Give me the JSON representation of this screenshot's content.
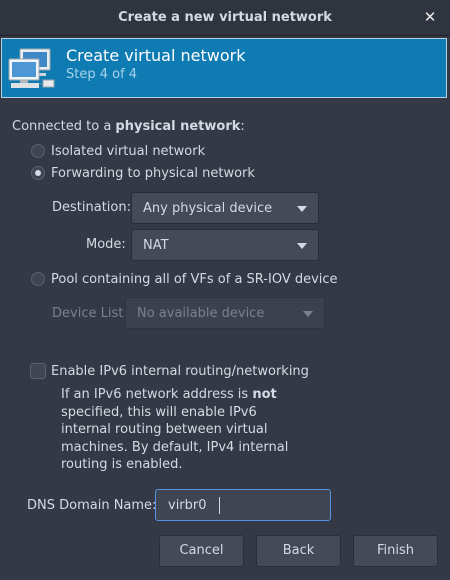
{
  "window": {
    "title": "Create a new virtual network"
  },
  "banner": {
    "title": "Create virtual network",
    "step": "Step 4 of 4",
    "icon": "network-computers-icon"
  },
  "connection": {
    "heading_prefix": "Connected to a ",
    "heading_bold": "physical network",
    "heading_suffix": ":",
    "isolated_label": "Isolated virtual network",
    "forwarding_label": "Forwarding to physical network",
    "selected": "forwarding",
    "destination_label": "Destination:",
    "destination_value": "Any physical device",
    "mode_label": "Mode:",
    "mode_value": "NAT",
    "pool_label": "Pool containing all of VFs of a SR-IOV device",
    "device_list_label": "Device List:",
    "device_list_value": "No available device"
  },
  "ipv6": {
    "label": "Enable IPv6 internal routing/networking",
    "checked": false,
    "info_1": "If an IPv6 network address is ",
    "info_bold": "not",
    "info_2": " specified, this will enable IPv6 internal routing between virtual machines.  By default, IPv4 internal routing is enabled."
  },
  "dns": {
    "label": "DNS Domain Name:",
    "value": "virbr0"
  },
  "buttons": {
    "cancel": "Cancel",
    "back": "Back",
    "finish": "Finish"
  }
}
